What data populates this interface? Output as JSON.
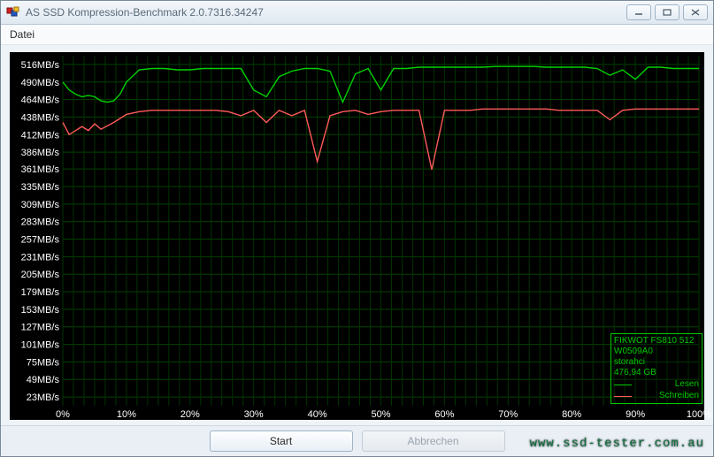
{
  "window": {
    "title": "AS SSD Kompression-Benchmark 2.0.7316.34247"
  },
  "menu": {
    "file": "Datei"
  },
  "buttons": {
    "start": "Start",
    "cancel": "Abbrechen"
  },
  "legend": {
    "device": "FIKWOT FS810 512",
    "serial": "W0509A0",
    "driver": "storahci",
    "capacity": "476,94 GB",
    "read_label": "Lesen",
    "write_label": "Schreiben"
  },
  "watermark": "www.ssd-tester.com.au",
  "chart_data": {
    "type": "line",
    "title": "",
    "xlabel": "",
    "ylabel": "",
    "y_unit": "MB/s",
    "xlim": [
      0,
      100
    ],
    "ylim": [
      10,
      529
    ],
    "y_ticks": [
      23,
      49,
      75,
      101,
      127,
      153,
      179,
      205,
      231,
      257,
      283,
      309,
      335,
      361,
      386,
      412,
      438,
      464,
      490,
      516
    ],
    "x_ticks_pct": [
      0,
      10,
      20,
      30,
      40,
      50,
      60,
      70,
      80,
      90,
      100
    ],
    "vgrid_count": 60,
    "series": [
      {
        "name": "Lesen",
        "color": "#00d000",
        "x": [
          0,
          1,
          2,
          3,
          4,
          5,
          6,
          7,
          8,
          9,
          10,
          12,
          14,
          16,
          18,
          20,
          22,
          24,
          26,
          28,
          30,
          32,
          34,
          36,
          38,
          40,
          42,
          44,
          46,
          48,
          50,
          52,
          54,
          56,
          58,
          60,
          62,
          64,
          66,
          68,
          70,
          72,
          74,
          76,
          78,
          80,
          82,
          84,
          86,
          88,
          90,
          92,
          94,
          96,
          98,
          100
        ],
        "values": [
          490,
          478,
          472,
          468,
          470,
          468,
          462,
          460,
          462,
          472,
          490,
          508,
          510,
          510,
          508,
          508,
          510,
          510,
          510,
          510,
          478,
          468,
          498,
          506,
          510,
          510,
          506,
          460,
          502,
          510,
          478,
          510,
          510,
          512,
          512,
          512,
          512,
          512,
          512,
          513,
          513,
          513,
          513,
          512,
          512,
          512,
          512,
          510,
          500,
          508,
          494,
          512,
          512,
          510,
          510,
          510
        ]
      },
      {
        "name": "Schreiben",
        "color": "#ff5a5a",
        "x": [
          0,
          1,
          2,
          3,
          4,
          5,
          6,
          7,
          8,
          9,
          10,
          12,
          14,
          16,
          18,
          20,
          22,
          24,
          26,
          28,
          30,
          32,
          34,
          36,
          38,
          40,
          42,
          44,
          46,
          48,
          50,
          52,
          54,
          56,
          58,
          60,
          62,
          64,
          66,
          68,
          70,
          72,
          74,
          76,
          78,
          80,
          82,
          84,
          86,
          88,
          90,
          92,
          94,
          96,
          98,
          100
        ],
        "values": [
          430,
          412,
          418,
          424,
          418,
          428,
          420,
          425,
          430,
          436,
          442,
          446,
          448,
          448,
          448,
          448,
          448,
          448,
          446,
          440,
          448,
          430,
          448,
          440,
          448,
          372,
          440,
          446,
          448,
          442,
          446,
          448,
          448,
          448,
          360,
          448,
          448,
          448,
          450,
          450,
          450,
          450,
          450,
          450,
          448,
          448,
          448,
          448,
          434,
          448,
          450,
          450,
          450,
          450,
          450,
          450
        ]
      }
    ]
  }
}
